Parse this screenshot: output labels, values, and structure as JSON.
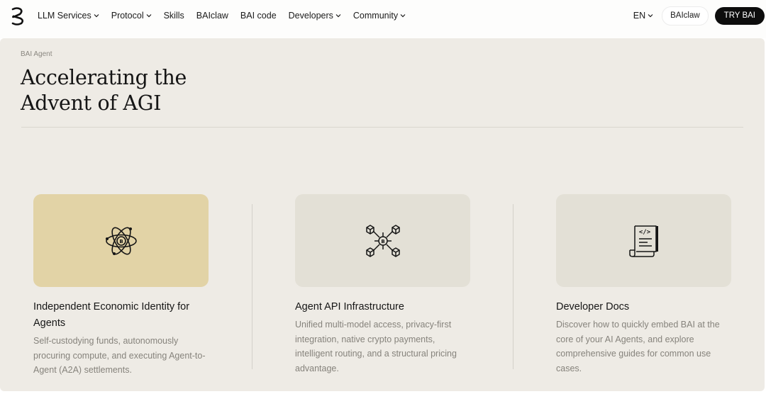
{
  "nav": {
    "items": [
      {
        "label": "LLM Services",
        "dropdown": true
      },
      {
        "label": "Protocol",
        "dropdown": true
      },
      {
        "label": "Skills",
        "dropdown": false
      },
      {
        "label": "BAIclaw",
        "dropdown": false
      },
      {
        "label": "BAI code",
        "dropdown": false
      },
      {
        "label": "Developers",
        "dropdown": true
      },
      {
        "label": "Community",
        "dropdown": true
      }
    ],
    "lang": "EN",
    "secondary_button": "BAIclaw",
    "primary_button": "TRY BAI"
  },
  "hero": {
    "breadcrumb": "BAI Agent",
    "title_line1": "Accelerating the",
    "title_line2": "Advent of AGI"
  },
  "cards": [
    {
      "icon": "atom-icon",
      "title": "Independent Economic Identity for Agents",
      "desc": "Self-custodying funds, autonomously procuring compute, and executing Agent-to-Agent (A2A) settlements."
    },
    {
      "icon": "network-cubes-icon",
      "title": "Agent API Infrastructure",
      "desc": "Unified multi-model access, privacy-first integration, native crypto payments, intelligent routing, and a structural pricing advantage."
    },
    {
      "icon": "code-document-icon",
      "title": "Developer Docs",
      "desc": "Discover how to quickly embed BAI at the core of your AI Agents, and explore comprehensive guides for common use cases."
    }
  ],
  "colors": {
    "page_bg": "#eeebe5",
    "highlight_tile": "#e2d3a6",
    "tile": "#e3e0d6",
    "primary_button_bg": "#0d0d0d"
  }
}
